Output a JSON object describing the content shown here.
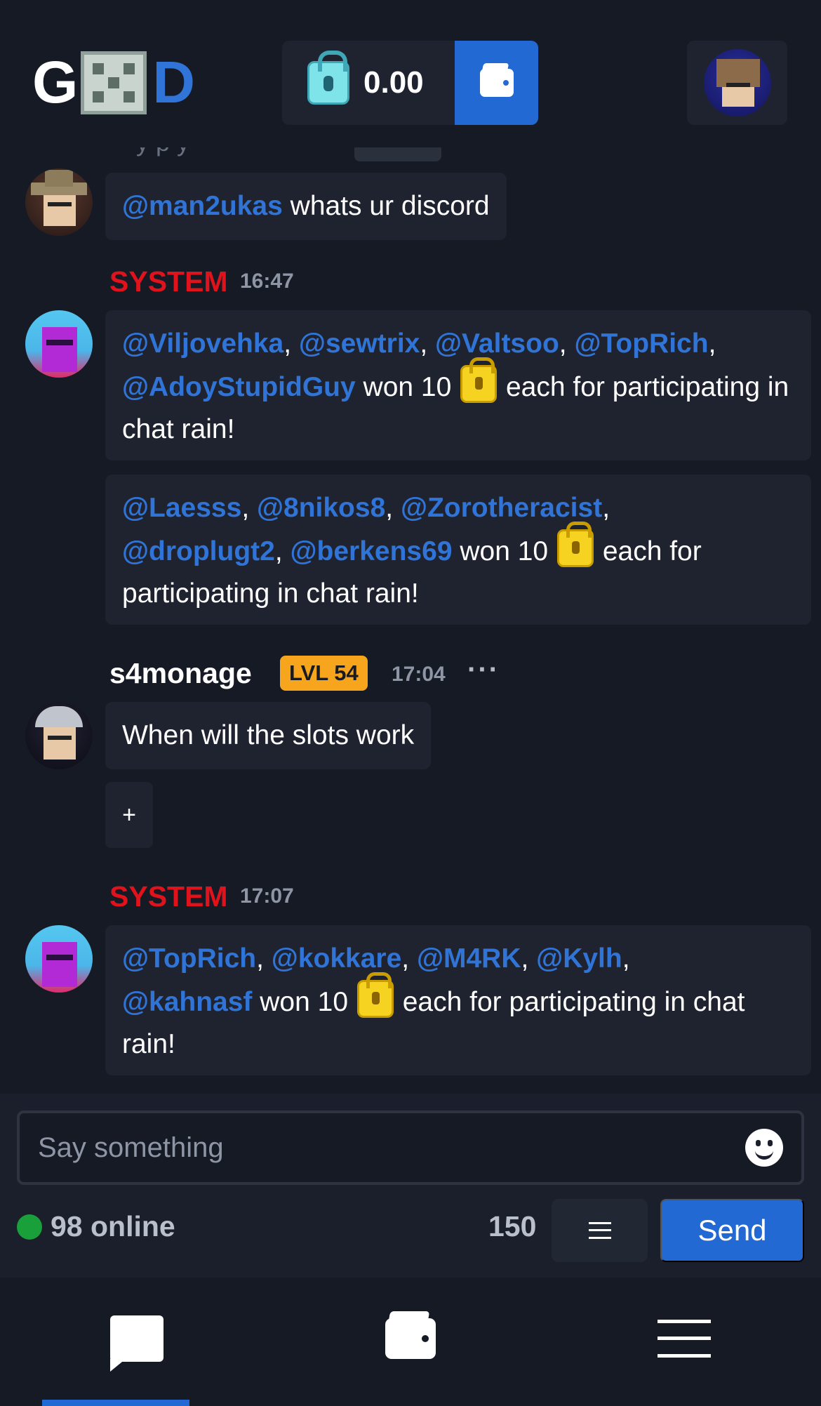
{
  "header": {
    "logo": {
      "left": "G",
      "right": "D"
    },
    "balance": "0.00",
    "balance_icon": "blue-lock-icon",
    "wallet_icon": "wallet-icon",
    "accent": "#2269d3"
  },
  "chat": {
    "partial_message": {
      "text": "·· y   p       y"
    },
    "messages": [
      {
        "type": "user",
        "avatar": "cowboy-hat-avatar",
        "mentions": [
          "@man2ukas"
        ],
        "text": " whats ur discord"
      },
      {
        "type": "system",
        "name": "SYSTEM",
        "time": "16:47",
        "name_color": "#e0121c",
        "bubbles": [
          {
            "mentions": [
              "@Viljovehka",
              "@sewtrix",
              "@Valtsoo",
              "@TopRich",
              "@AdoyStupidGuy"
            ],
            "won": "won 10",
            "suffix": "each for participating in chat rain!"
          },
          {
            "mentions": [
              "@Laesss",
              "@8nikos8",
              "@Zorotheracist",
              "@droplugt2",
              "@berkens69"
            ],
            "won": "won 10",
            "suffix": "each for participating in chat rain!"
          }
        ]
      },
      {
        "type": "user",
        "name": "s4monage",
        "level": "LVL 54",
        "time": "17:04",
        "more": "···",
        "text": "When will the slots work",
        "reaction_add": "+"
      },
      {
        "type": "system",
        "name": "SYSTEM",
        "time": "17:07",
        "bubbles": [
          {
            "mentions": [
              "@TopRich",
              "@kokkare",
              "@M4RK",
              "@Kylh",
              "@kahnasf"
            ],
            "won": "won 10",
            "suffix": "each for participating in chat rain!"
          }
        ]
      }
    ],
    "reward_icon": "gold-lock-icon"
  },
  "composer": {
    "placeholder": "Say something",
    "emoji_icon": "smiley-icon",
    "online_text": "98 online",
    "online_color": "#1aa03a",
    "char_limit": "150",
    "send_label": "Send"
  },
  "bottom_nav": [
    {
      "icon": "chat-icon",
      "active": true
    },
    {
      "icon": "wallet-icon",
      "active": false
    },
    {
      "icon": "menu-icon",
      "active": false
    }
  ]
}
